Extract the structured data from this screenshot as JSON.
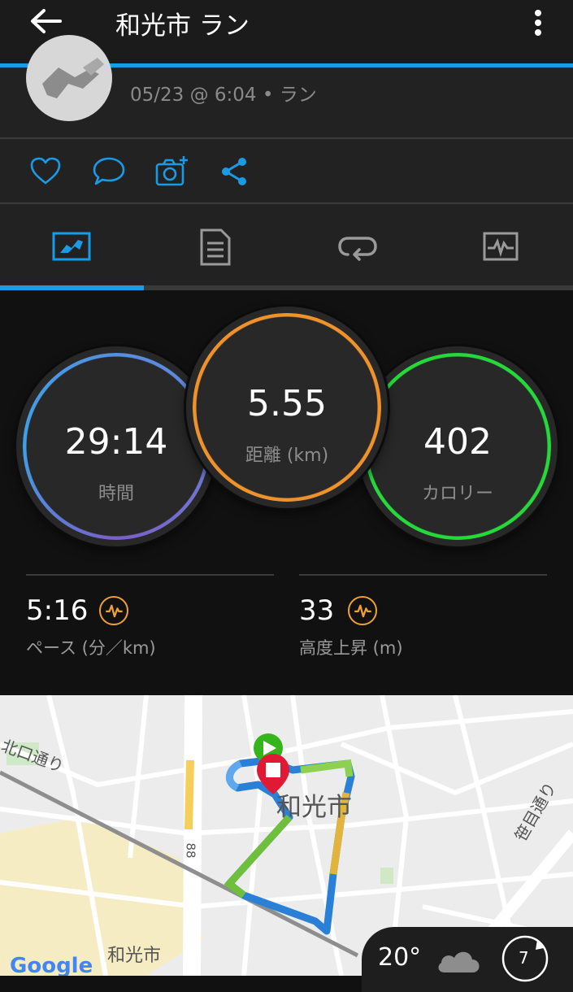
{
  "header": {
    "title": "和光市 ラン"
  },
  "activity": {
    "subtitle": "05/23 @ 6:04 • ラン"
  },
  "actions": [
    "like-icon",
    "comment-icon",
    "add-photo-icon",
    "share-icon"
  ],
  "tabs": [
    "overview-icon",
    "details-icon",
    "laps-icon",
    "charts-icon"
  ],
  "stats": {
    "time": {
      "value": "29:14",
      "label": "時間"
    },
    "distance": {
      "value": "5.55",
      "label": "距離 (km)"
    },
    "calories": {
      "value": "402",
      "label": "カロリー"
    },
    "pace": {
      "value": "5:16",
      "label": "ペース (分／km)"
    },
    "elevation": {
      "value": "33",
      "label": "高度上昇 (m)"
    }
  },
  "map": {
    "labels": {
      "city": "和光市",
      "street_north": "北口通り",
      "street_east": "笹目通り",
      "station": "和光市",
      "road_number": "88"
    },
    "google": "Google"
  },
  "weather": {
    "temperature": "20°",
    "wind": "7"
  },
  "colors": {
    "accent": "#1a9be6",
    "time_ring": [
      "#3ea0e8",
      "#7b5fc7"
    ],
    "distance_ring": "#f0922a",
    "calories_ring": "#25d93a",
    "badge": "#f0a030"
  }
}
